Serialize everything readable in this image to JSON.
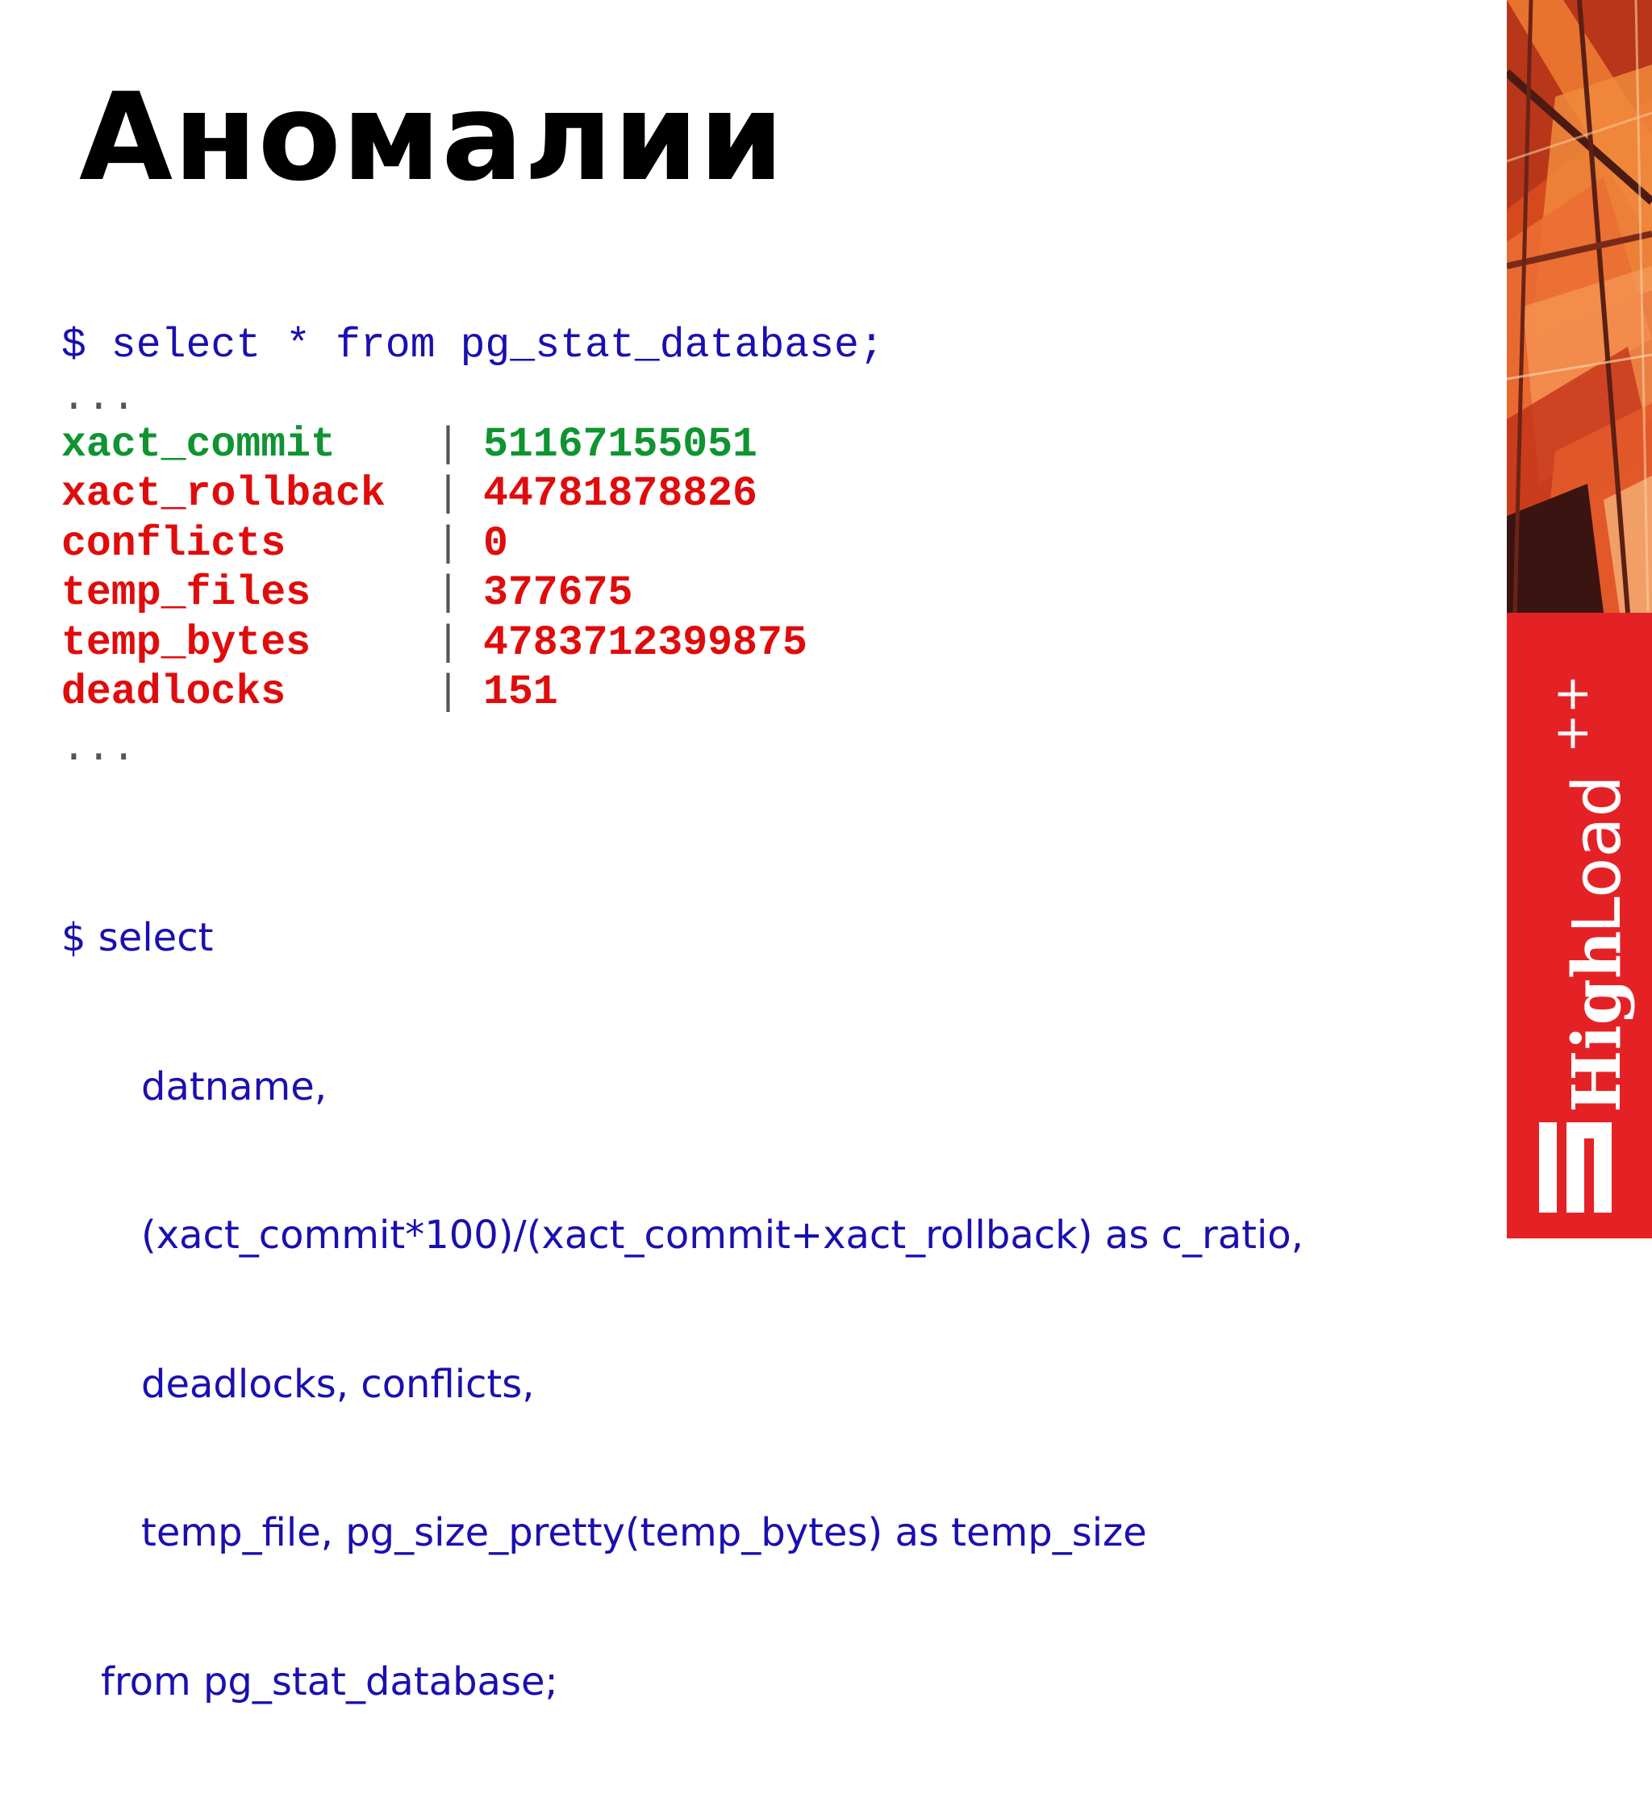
{
  "slide": {
    "title": "Аномалии",
    "query1": "$ select * from pg_stat_database;",
    "ellipsis_top": "...",
    "stats": [
      {
        "name": "xact_commit",
        "value": "51167155051"
      },
      {
        "name": "xact_rollback",
        "value": "44781878826"
      },
      {
        "name": "conflicts",
        "value": "0"
      },
      {
        "name": "temp_files",
        "value": "377675"
      },
      {
        "name": "temp_bytes",
        "value": "4783712399875"
      },
      {
        "name": "deadlocks",
        "value": "151"
      }
    ],
    "stat_separator": "|",
    "ellipsis_bottom": "...",
    "query2": [
      "$ select",
      "datname,",
      "(xact_commit*100)/(xact_commit+xact_rollback) as c_ratio,",
      "deadlocks, conflicts,",
      "temp_file, pg_size_pretty(temp_bytes) as temp_size",
      "from pg_stat_database;"
    ]
  },
  "brand": {
    "logo_text": "HighLoad++"
  },
  "colors": {
    "title": "#000000",
    "query": "#1a0fb0",
    "ok_row": "#0f9431",
    "bad_row": "#e00c0c",
    "brand_red": "#e42226",
    "ellipsis": "#555555"
  }
}
